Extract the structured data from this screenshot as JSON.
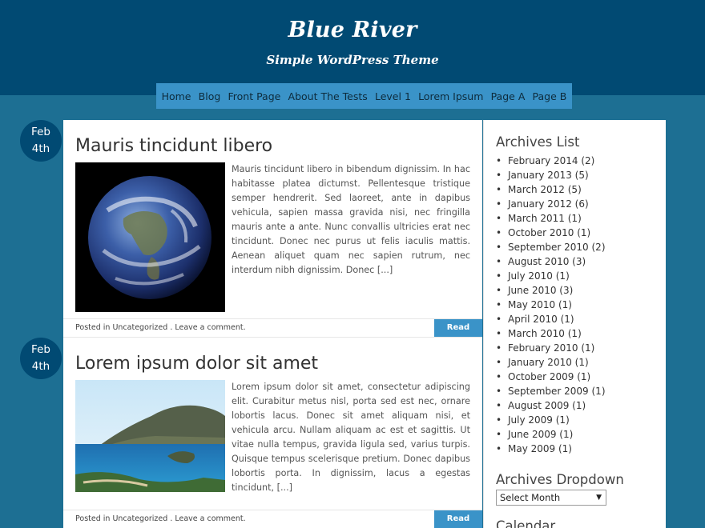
{
  "site": {
    "title": "Blue River",
    "description": "Simple WordPress Theme"
  },
  "nav": {
    "items": [
      "Home",
      "Blog",
      "Front Page",
      "About The Tests",
      "Level 1",
      "Lorem Ipsum",
      "Page A",
      "Page B"
    ]
  },
  "posts": [
    {
      "date_month": "Feb",
      "date_day": "4th",
      "title": "Mauris tincidunt libero",
      "excerpt": "Mauris tincidunt libero in bibendum dignissim. In hac habitasse platea dictumst. Pellentesque tristique semper hendrerit. Sed laoreet, ante in dapibus vehicula, sapien massa gravida nisi, nec fringilla mauris ante a ante. Nunc convallis ultricies erat nec tincidunt. Donec nec purus ut felis iaculis mattis. Aenean aliquet quam nec sapien rutrum, nec interdum nibh dignissim. Donec [...]",
      "meta_prefix": "Posted in ",
      "category": "Uncategorized",
      "comment_link": "Leave a comment.",
      "read_more": "Read more",
      "image": "earth-photo"
    },
    {
      "date_month": "Feb",
      "date_day": "4th",
      "title": "Lorem ipsum dolor sit amet",
      "excerpt": "Lorem ipsum dolor sit amet, consectetur adipiscing elit. Curabitur metus nisl, porta sed est nec, ornare lobortis lacus. Donec sit amet aliquam nisi, et vehicula arcu. Nullam aliquam ac est et sagittis. Ut vitae nulla tempus, gravida ligula sed, varius turpis. Quisque tempus scelerisque pretium. Donec dapibus lobortis porta. In dignissim, lacus a egestas tincidunt, [...]",
      "meta_prefix": "Posted in ",
      "category": "Uncategorized",
      "comment_link": "Leave a comment.",
      "read_more": "Read more",
      "image": "coast-photo"
    }
  ],
  "sidebar": {
    "archives_title": "Archives List",
    "archives": [
      "February 2014 (2)",
      "January 2013 (5)",
      "March 2012 (5)",
      "January 2012 (6)",
      "March 2011 (1)",
      "October 2010 (1)",
      "September 2010 (2)",
      "August 2010 (3)",
      "July 2010 (1)",
      "June 2010 (3)",
      "May 2010 (1)",
      "April 2010 (1)",
      "March 2010 (1)",
      "February 2010 (1)",
      "January 2010 (1)",
      "October 2009 (1)",
      "September 2009 (1)",
      "August 2009 (1)",
      "July 2009 (1)",
      "June 2009 (1)",
      "May 2009 (1)"
    ],
    "dropdown_title": "Archives Dropdown",
    "dropdown_selected": "Select Month",
    "next_widget_title": "Calendar"
  },
  "colors": {
    "page_bg": "#1d6f93",
    "header_bg": "#014a73",
    "nav_bg": "#3a93c8",
    "badge_bg": "#014a73"
  }
}
